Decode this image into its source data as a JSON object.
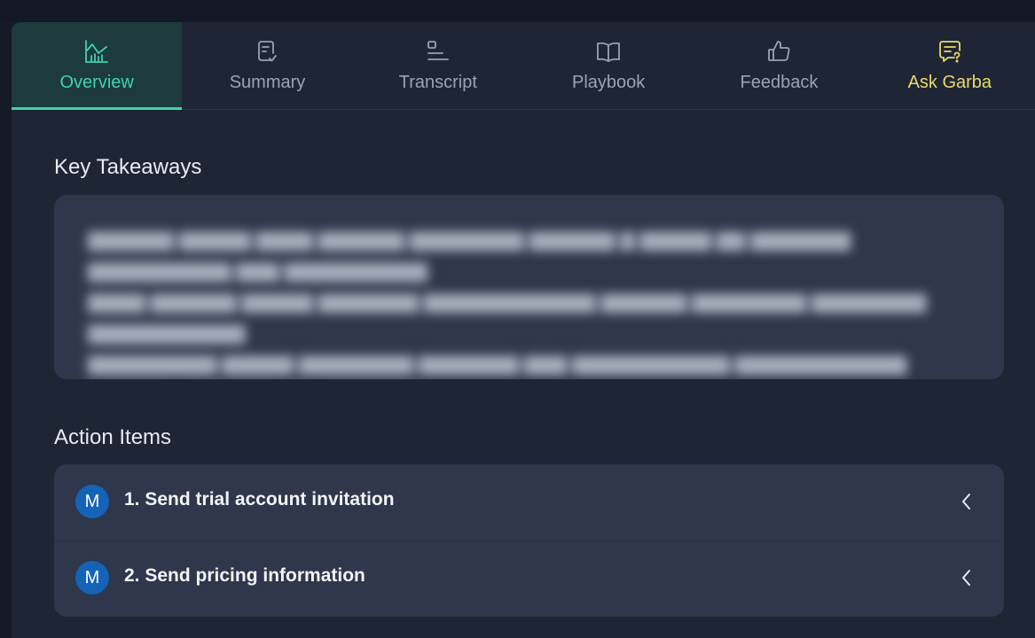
{
  "tabs": [
    {
      "label": "Overview",
      "icon": "chart-icon",
      "active": true
    },
    {
      "label": "Summary",
      "icon": "document-check-icon"
    },
    {
      "label": "Transcript",
      "icon": "transcript-icon"
    },
    {
      "label": "Playbook",
      "icon": "book-icon"
    },
    {
      "label": "Feedback",
      "icon": "thumbs-up-icon"
    },
    {
      "label": "Ask Garba",
      "icon": "chat-question-icon"
    }
  ],
  "key_takeaways": {
    "title": "Key Takeaways"
  },
  "action_items": {
    "title": "Action Items",
    "items": [
      {
        "avatar": "M",
        "number": "1.",
        "text": "Send trial account invitation"
      },
      {
        "avatar": "M",
        "number": "2.",
        "text": "Send pricing information"
      }
    ]
  },
  "colors": {
    "accent": "#3fd3a8",
    "ask_accent": "#ead96a",
    "panel_bg": "#1e2535",
    "card_bg": "#2e374b",
    "avatar_bg": "#1463b6"
  }
}
